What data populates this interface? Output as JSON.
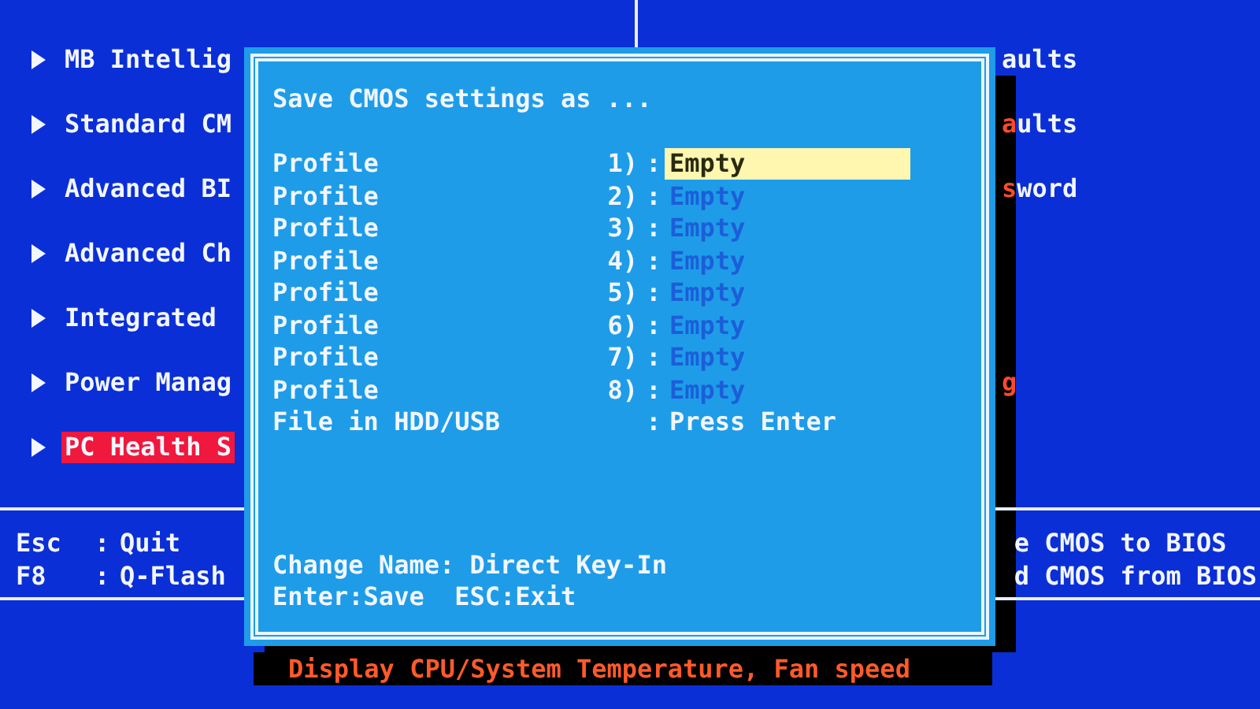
{
  "menu": {
    "rows": [
      {
        "left": {
          "label": "MB Intellig",
          "selected": false
        },
        "right": {
          "parts": [
            {
              "text": "aults",
              "hot": false
            }
          ]
        }
      },
      {
        "left": {
          "label": "Standard CM",
          "selected": false
        },
        "right": {
          "parts": [
            {
              "text": "a",
              "hot": true
            },
            {
              "text": "ults",
              "hot": false
            }
          ]
        }
      },
      {
        "left": {
          "label": "Advanced BI",
          "selected": false
        },
        "right": {
          "parts": [
            {
              "text": "s",
              "hot": true
            },
            {
              "text": "word",
              "hot": false
            }
          ]
        }
      },
      {
        "left": {
          "label": "Advanced Ch",
          "selected": false
        }
      },
      {
        "left": {
          "label": "Integrated",
          "selected": false
        }
      },
      {
        "left": {
          "label": "Power Manag",
          "selected": false
        },
        "right": {
          "parts": [
            {
              "text": "g",
              "hot": true
            }
          ]
        }
      },
      {
        "left": {
          "label": "PC Health S",
          "selected": true
        }
      }
    ]
  },
  "key_help": {
    "left": [
      {
        "key": "Esc",
        "sep": ":",
        "action": "Quit"
      },
      {
        "key": "F8",
        "sep": ":",
        "action": "Q-Flash"
      }
    ],
    "right": [
      "e CMOS to BIOS",
      "d CMOS from BIOS"
    ]
  },
  "dialog": {
    "title": "Save CMOS settings as ...",
    "profiles": [
      {
        "label": "Profile",
        "number": "1)",
        "sep": ":",
        "value": "Empty",
        "selected": true
      },
      {
        "label": "Profile",
        "number": "2)",
        "sep": ":",
        "value": "Empty",
        "selected": false
      },
      {
        "label": "Profile",
        "number": "3)",
        "sep": ":",
        "value": "Empty",
        "selected": false
      },
      {
        "label": "Profile",
        "number": "4)",
        "sep": ":",
        "value": "Empty",
        "selected": false
      },
      {
        "label": "Profile",
        "number": "5)",
        "sep": ":",
        "value": "Empty",
        "selected": false
      },
      {
        "label": "Profile",
        "number": "6)",
        "sep": ":",
        "value": "Empty",
        "selected": false
      },
      {
        "label": "Profile",
        "number": "7)",
        "sep": ":",
        "value": "Empty",
        "selected": false
      },
      {
        "label": "Profile",
        "number": "8)",
        "sep": ":",
        "value": "Empty",
        "selected": false
      }
    ],
    "file_row": {
      "label": "File in HDD/USB",
      "sep": ":",
      "value": "Press Enter"
    },
    "footer": [
      "Change Name: Direct Key-In",
      "Enter:Save  ESC:Exit"
    ]
  },
  "status_bar": "Display CPU/System Temperature, Fan speed"
}
